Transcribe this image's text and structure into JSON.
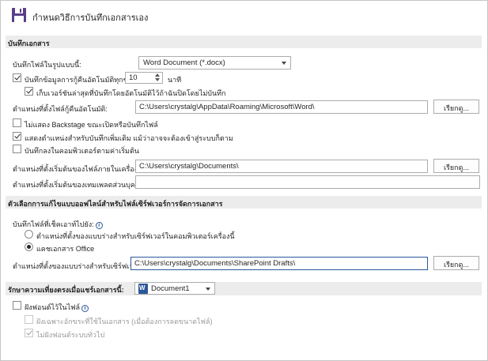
{
  "header": {
    "title": "กำหนดวิธีการบันทึกเอกสารเอง"
  },
  "save_section": {
    "title": "บันทึกเอกสาร",
    "format_label": "บันทึกไฟล์ในรูปแบบนี้:",
    "format_value": "Word Document (*.docx)",
    "autorecover_label": "บันทึกข้อมูลการกู้คืนอัตโนมัติทุกๆ",
    "autorecover_minutes": "10",
    "minutes_label": "นาที",
    "keep_last_label": "เก็บเวอร์ชันล่าสุดที่บันทึกโดยอัตโนมัติไว้ถ้าฉันปิดโดยไม่บันทึก",
    "autorecover_location_label": "ตำแหน่งที่ตั้งไฟล์กู้คืนอัตโนมัติ:",
    "autorecover_location_value": "C:\\Users\\crystalg\\AppData\\Roaming\\Microsoft\\Word\\",
    "browse_label": "เรียกดู...",
    "no_backstage_label": "ไม่แสดง Backstage ขณะเปิดหรือบันทึกไฟล์",
    "show_locations_label": "แสดงตำแหน่งสำหรับบันทึกเพิ่มเติม แม้ว่าอาจจะต้องเข้าสู่ระบบก็ตาม",
    "save_to_computer_label": "บันทึกลงในคอมพิวเตอร์ตามค่าเริ่มต้น",
    "default_local_label": "ตำแหน่งที่ตั้งเริ่มต้นของไฟล์ภายในเครื่อง:",
    "default_local_value": "C:\\Users\\crystalg\\Documents\\",
    "templates_label": "ตำแหน่งที่ตั้งเริ่มต้นของเทมเพลตส่วนบุคคล:",
    "templates_value": ""
  },
  "offline_section": {
    "title": "ตัวเลือกการแก้ไขแบบออฟไลน์สำหรับไฟล์เซิร์ฟเวอร์การจัดการเอกสาร",
    "save_checked_out_label": "บันทึกไฟล์ที่เช็คเอาท์ไปยัง:",
    "radio_server_drafts": "ตำแหน่งที่ตั้งของแบบร่างสำหรับเซิร์ฟเวอร์ในคอมพิวเตอร์เครื่องนี้",
    "radio_office_cache": "แคชเอกสาร Office",
    "server_drafts_label": "ตำแหน่งที่ตั้งของแบบร่างสำหรับเซิร์ฟเวอร์:",
    "server_drafts_value": "C:\\Users\\crystalg\\Documents\\SharePoint Drafts\\",
    "browse_label": "เรียกดู..."
  },
  "fidelity_section": {
    "title": "รักษาความเที่ยงตรงเมื่อแชร์เอกสารนี้:",
    "document_value": "Document1",
    "embed_fonts_label": "ฝังฟอนต์ไว้ในไฟล์",
    "embed_subset_label": "ฝังเฉพาะอักขระที่ใช้ในเอกสาร (เมื่อต้องการลดขนาดไฟล์)",
    "no_common_fonts_label": "ไม่ฝังฟอนต์ระบบทั่วไป"
  },
  "colors": {
    "accent": "#2b579a",
    "section_bg": "#ececec"
  },
  "icons": {
    "header": "save-floppy-icon",
    "info": "info-icon",
    "document": "word-document-icon"
  }
}
